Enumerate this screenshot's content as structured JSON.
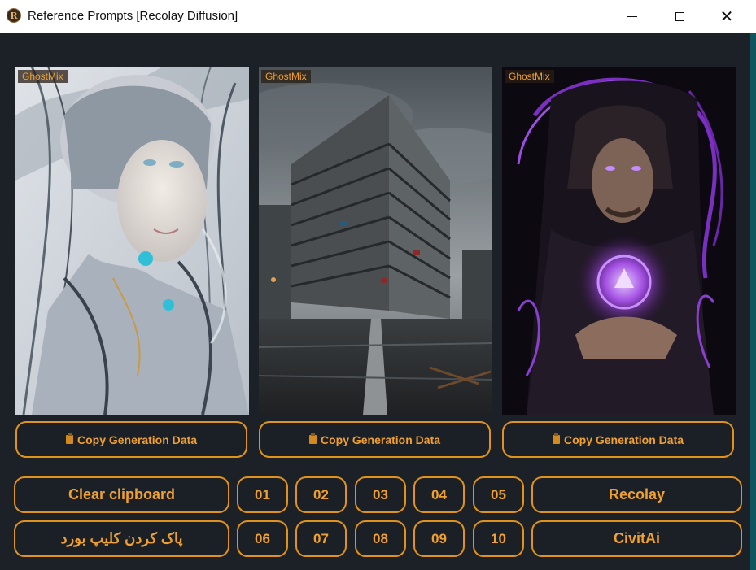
{
  "window": {
    "title": "Reference Prompts [Recolay Diffusion]",
    "app_icon_letter": "R"
  },
  "cards": [
    {
      "model": "GhostMix",
      "copy_label": "Copy Generation Data",
      "image": "cyborg-woman-portrait"
    },
    {
      "model": "GhostMix",
      "copy_label": "Copy Generation Data",
      "image": "abandoned-apartment-building"
    },
    {
      "model": "GhostMix",
      "copy_label": "Copy Generation Data",
      "image": "sorcerer-with-purple-orb"
    }
  ],
  "buttons": {
    "clear_clipboard": "Clear clipboard",
    "clear_clipboard_fa": "پاک کردن کلیپ بورد",
    "numbers_row1": [
      "01",
      "02",
      "03",
      "04",
      "05"
    ],
    "numbers_row2": [
      "06",
      "07",
      "08",
      "09",
      "10"
    ],
    "recolay": "Recolay",
    "civitai": "CivitAi"
  },
  "colors": {
    "background": "#1c2128",
    "accent": "#e0921c",
    "accent_text": "#f0a030"
  }
}
